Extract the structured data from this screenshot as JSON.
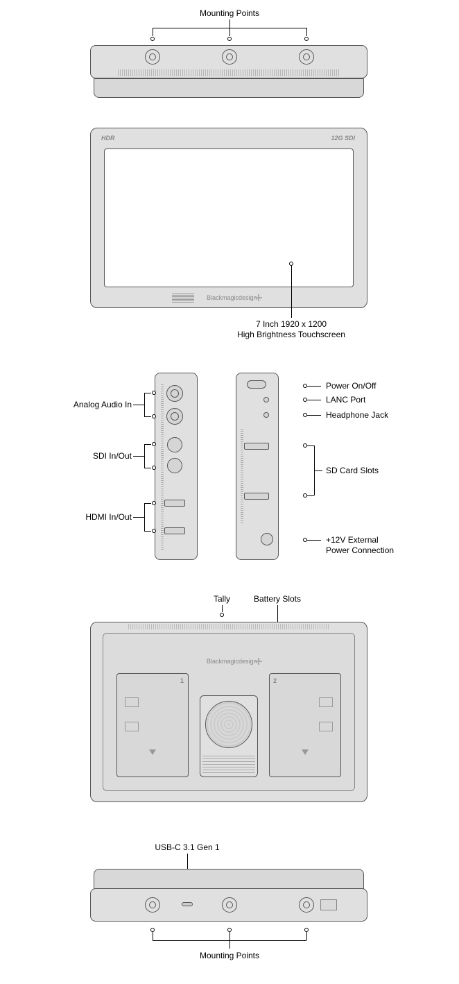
{
  "top": {
    "mounting_points": "Mounting Points"
  },
  "front": {
    "hdr": "HDR",
    "sdi_badge": "12G SDI",
    "brand": "Blackmagicdesign",
    "screen_line1": "7 Inch 1920 x 1200",
    "screen_line2": "High Brightness Touchscreen"
  },
  "left_side": {
    "analog_audio": "Analog Audio In",
    "sdi": "SDI In/Out",
    "hdmi": "HDMI In/Out"
  },
  "right_side": {
    "power": "Power On/Off",
    "lanc": "LANC Port",
    "headphone": "Headphone Jack",
    "sd": "SD Card Slots",
    "power12v_line1": "+12V External",
    "power12v_line2": "Power Connection"
  },
  "back": {
    "tally": "Tally",
    "battery_slots": "Battery Slots",
    "brand": "Blackmagicdesign",
    "slot1": "1",
    "slot2": "2"
  },
  "bottom": {
    "usb": "USB-C 3.1 Gen 1",
    "mounting_points": "Mounting Points"
  }
}
